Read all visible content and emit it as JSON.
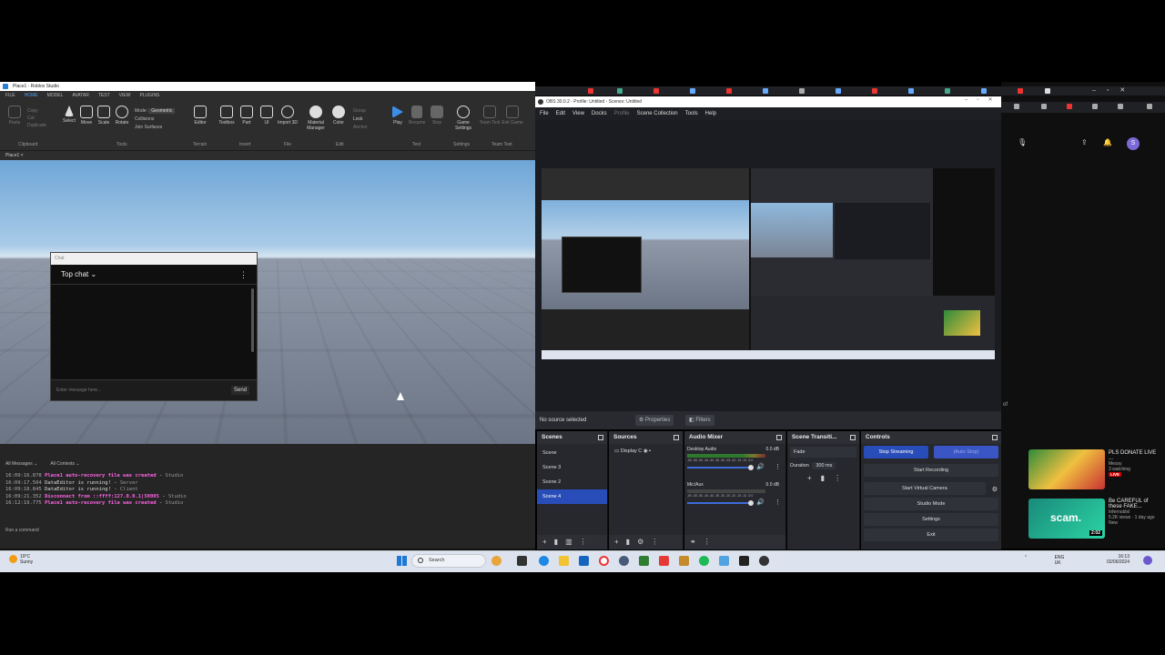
{
  "roblox": {
    "title": "Place1 - Roblox Studio",
    "menu_tabs": [
      "FILE",
      "HOME",
      "MODEL",
      "AVATAR",
      "TEST",
      "VIEW",
      "PLUGINS"
    ],
    "active_tab": "HOME",
    "ribbon": {
      "tools": [
        "Select",
        "Move",
        "Scale",
        "Rotate"
      ],
      "mode_label": "Mode:",
      "mode_value": "Geometric",
      "collisions": "Collisions",
      "join_surfaces": "Join Surfaces",
      "editor": "Editor",
      "toolbox": "Toolbox",
      "part": "Part",
      "ui": "UI",
      "import3d": "Import 3D",
      "material_manager": "Material Manager",
      "color": "Color",
      "group": "Group",
      "lock": "Lock",
      "anchor": "Anchor",
      "play": "Play",
      "resume": "Resume",
      "stop": "Stop",
      "game_settings": "Game Settings",
      "team_test": "Team Test",
      "exit_game": "Exit Game",
      "groups": [
        "Clipboard",
        "Tools",
        "Terrain",
        "Insert",
        "File",
        "Edit",
        "Test",
        "Settings",
        "Team Test"
      ],
      "clipboard_items": [
        "Paste",
        "Copy",
        "Cut",
        "Duplicate"
      ]
    },
    "doc_tab": "Place1",
    "chat": {
      "bar_label": "Chat",
      "header": "Top chat",
      "placeholder": "Enter message here...",
      "send": "Send"
    },
    "output": {
      "filter1": "All Messages",
      "filter2": "All Contexts",
      "lines": [
        {
          "time": "16:09:16.878",
          "msg": "Place1 auto-recovery file was created",
          "src": "Studio",
          "style": "red"
        },
        {
          "time": "16:09:17.504",
          "msg": "DataEditor is running!",
          "src": "Server",
          "style": "white"
        },
        {
          "time": "16:09:18.845",
          "msg": "DataEditor is running!",
          "src": "Client",
          "style": "white"
        },
        {
          "time": "16:09:21.352",
          "msg": "Disconnect from ::ffff:127.0.0.1|50005",
          "src": "Studio",
          "style": "red"
        },
        {
          "time": "16:12:19.775",
          "msg": "Place1 auto-recovery file was created",
          "src": "Studio",
          "style": "red"
        }
      ],
      "command_placeholder": "Run a command"
    }
  },
  "obs": {
    "title": "OBS 30.0.2 - Profile: Untitled - Scenes: Untitled",
    "menu": [
      "File",
      "Edit",
      "View",
      "Docks",
      "Profile",
      "Scene Collection",
      "Tools",
      "Help"
    ],
    "no_source": "No source selected",
    "properties": "Properties",
    "filters": "Filters",
    "scenes_title": "Scenes",
    "scenes": [
      "Scene",
      "Scene 3",
      "Scene 2",
      "Scene 4"
    ],
    "selected_scene": "Scene 4",
    "sources_title": "Sources",
    "source_item": "Display C",
    "mixer_title": "Audio Mixer",
    "mixer": [
      {
        "name": "Desktop Audio",
        "db": "0.0 dB"
      },
      {
        "name": "Mic/Aux",
        "db": "0.0 dB"
      }
    ],
    "meter_ticks": "-60 -55 -50 -45 -40 -35 -30 -25 -20 -15 -10 -5 0",
    "transitions_title": "Scene Transiti...",
    "transition": "Fade",
    "duration_label": "Duration",
    "duration_value": "300 ms",
    "controls_title": "Controls",
    "controls": {
      "stop_streaming": "Stop Streaming",
      "auto_stop": "(Auto Stop)",
      "start_recording": "Start Recording",
      "start_virtual_camera": "Start Virtual Camera",
      "studio_mode": "Studio Mode",
      "settings": "Settings",
      "exit": "Exit"
    }
  },
  "youtube": {
    "videos": [
      {
        "title": "PLS DONATE LIVE ...",
        "channel": "Messy",
        "meta": "3 watching",
        "badge": "LIVE"
      },
      {
        "title": "Be CAREFUL of these FAKE...",
        "channel": "Infernoblxl",
        "meta": "5.2K views · 1 day ago",
        "badge": "New",
        "duration": "2:02",
        "thumb_text": "scam."
      }
    ],
    "side_text": "of"
  },
  "taskbar": {
    "weather_temp": "19°C",
    "weather_desc": "Sunny",
    "search": "Search",
    "lang": "ENG",
    "region": "UK",
    "time": "16:13",
    "date": "02/06/2024"
  }
}
